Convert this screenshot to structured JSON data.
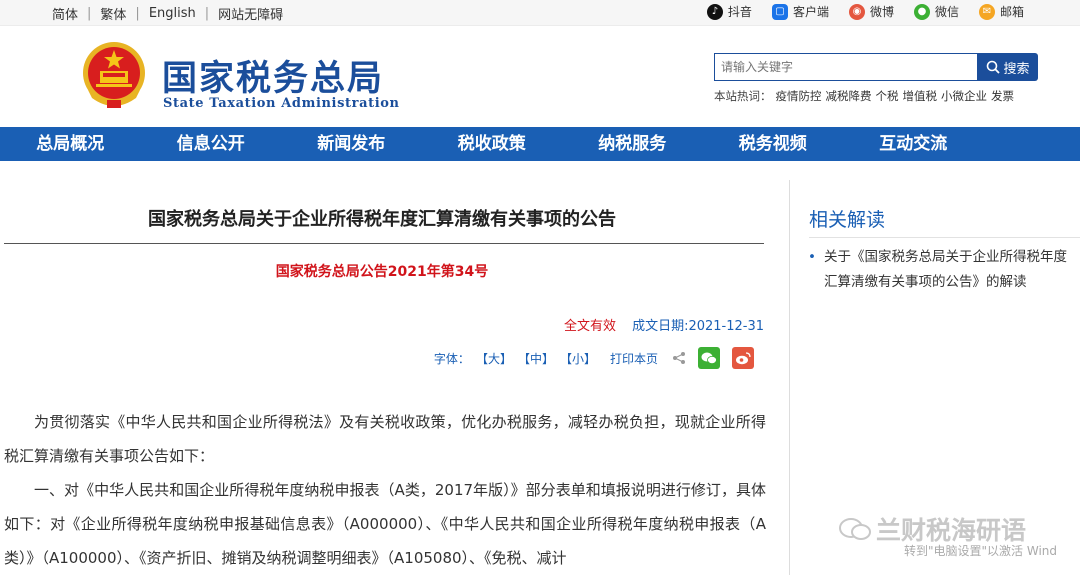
{
  "topbar": {
    "languages": [
      "简体",
      "繁体",
      "English",
      "网站无障碍"
    ],
    "social": [
      {
        "label": "抖音",
        "icon": "douyin-icon",
        "color": "#111111"
      },
      {
        "label": "客户端",
        "icon": "mobile-app-icon",
        "color": "#1a73e8"
      },
      {
        "label": "微博",
        "icon": "weibo-icon",
        "color": "#e4573f"
      },
      {
        "label": "微信",
        "icon": "wechat-icon",
        "color": "#3cb034"
      },
      {
        "label": "邮箱",
        "icon": "mail-icon",
        "color": "#f5a623"
      }
    ]
  },
  "header": {
    "site_name": "国家税务总局",
    "site_name_en": "State Taxation Administration",
    "search_placeholder": "请输入关键字",
    "search_button": "搜索",
    "hot_label": "本站热词：",
    "hot_words": [
      "疫情防控",
      "减税降费",
      "个税",
      "增值税",
      "小微企业",
      "发票"
    ]
  },
  "nav": [
    "总局概况",
    "信息公开",
    "新闻发布",
    "税收政策",
    "纳税服务",
    "税务视频",
    "互动交流"
  ],
  "article": {
    "title": "国家税务总局关于企业所得税年度汇算清缴有关事项的公告",
    "doc_number": "国家税务总局公告2021年第34号",
    "validity": "全文有效",
    "date": "成文日期:2021-12-31",
    "font_label": "字体：",
    "font_large": "【大】",
    "font_medium": "【中】",
    "font_small": "【小】",
    "print": "打印本页",
    "paragraphs": [
      "为贯彻落实《中华人民共和国企业所得税法》及有关税收政策，优化办税服务，减轻办税负担，现就企业所得税汇算清缴有关事项公告如下：",
      "一、对《中华人民共和国企业所得税年度纳税申报表（A类，2017年版）》部分表单和填报说明进行修订，具体如下：对《企业所得税年度纳税申报基础信息表》（A000000）、《中华人民共和国企业所得税年度纳税申报表（A类）》（A100000）、《资产折旧、摊销及纳税调整明细表》（A105080）、《免税、减计"
    ]
  },
  "sidebar": {
    "title": "相关解读",
    "items": [
      "关于《国家税务总局关于企业所得税年度汇算清缴有关事项的公告》的解读"
    ]
  },
  "watermark": {
    "text": "兰财税海研语",
    "activate": "转到\"电脑设置\"以激活 Wind"
  },
  "colors": {
    "brand": "#1b4e9b",
    "nav": "#1a5fb4",
    "red": "#d1141b"
  }
}
